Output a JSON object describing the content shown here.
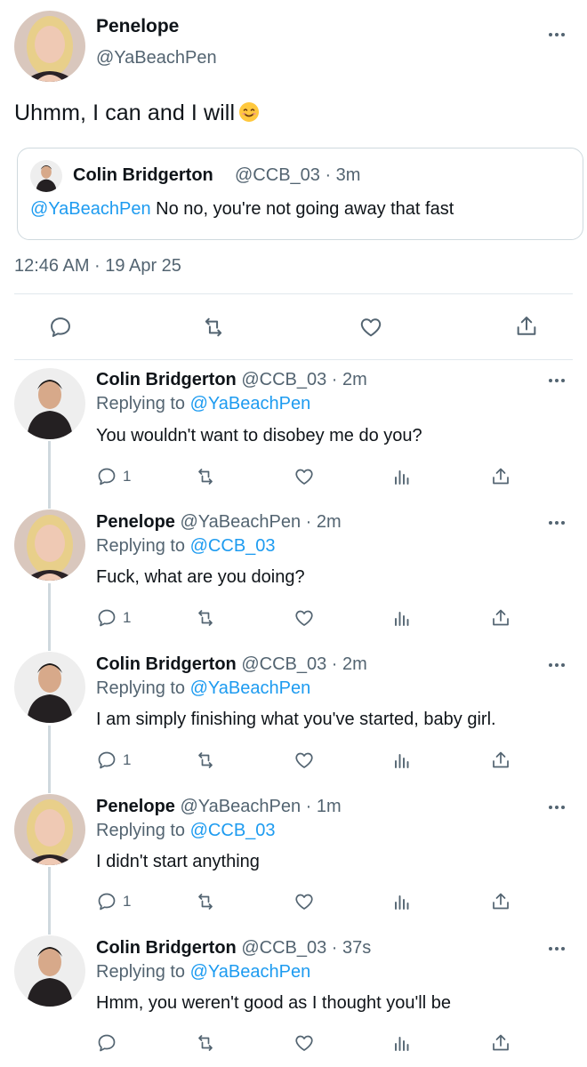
{
  "main_tweet": {
    "author_name": "Penelope",
    "author_handle": "@YaBeachPen",
    "text": "Uhmm, I can and I will",
    "emoji": "smiling-face-icon",
    "quote": {
      "author_name": "Colin Bridgerton",
      "meta": "@CCB_03 · 3m",
      "mention": "@YaBeachPen",
      "text": "No no, you're not going away that fast"
    },
    "timestamp": "12:46 AM · 19 Apr 25",
    "actions": [
      "reply-icon",
      "retweet-icon",
      "like-icon",
      "share-icon"
    ]
  },
  "replies": [
    {
      "author_name": "Colin Bridgerton",
      "meta": "@CCB_03 · 2m",
      "replying_to_prefix": "Replying to",
      "replying_to": "@YaBeachPen",
      "text": "You wouldn't want to disobey me do you?",
      "reply_count": "1",
      "avatar": "colin"
    },
    {
      "author_name": "Penelope",
      "meta": "@YaBeachPen · 2m",
      "replying_to_prefix": "Replying to",
      "replying_to": "@CCB_03",
      "text": "Fuck, what are you doing?",
      "reply_count": "1",
      "avatar": "penelope"
    },
    {
      "author_name": "Colin Bridgerton",
      "meta": "@CCB_03 · 2m",
      "replying_to_prefix": "Replying to",
      "replying_to": "@YaBeachPen",
      "text": "I am simply finishing what you've started, baby girl.",
      "reply_count": "1",
      "avatar": "colin"
    },
    {
      "author_name": "Penelope",
      "meta": "@YaBeachPen · 1m",
      "replying_to_prefix": "Replying to",
      "replying_to": "@CCB_03",
      "text": "I didn't start anything",
      "reply_count": "1",
      "avatar": "penelope"
    },
    {
      "author_name": "Colin Bridgerton",
      "meta": "@CCB_03 · 37s",
      "replying_to_prefix": "Replying to",
      "replying_to": "@YaBeachPen",
      "text": "Hmm, you weren't good as I thought you'll be",
      "reply_count": "",
      "avatar": "colin"
    }
  ],
  "colors": {
    "text": "#0f1419",
    "secondary": "#536471",
    "link": "#1d9bf0",
    "border": "#cfd9de"
  }
}
